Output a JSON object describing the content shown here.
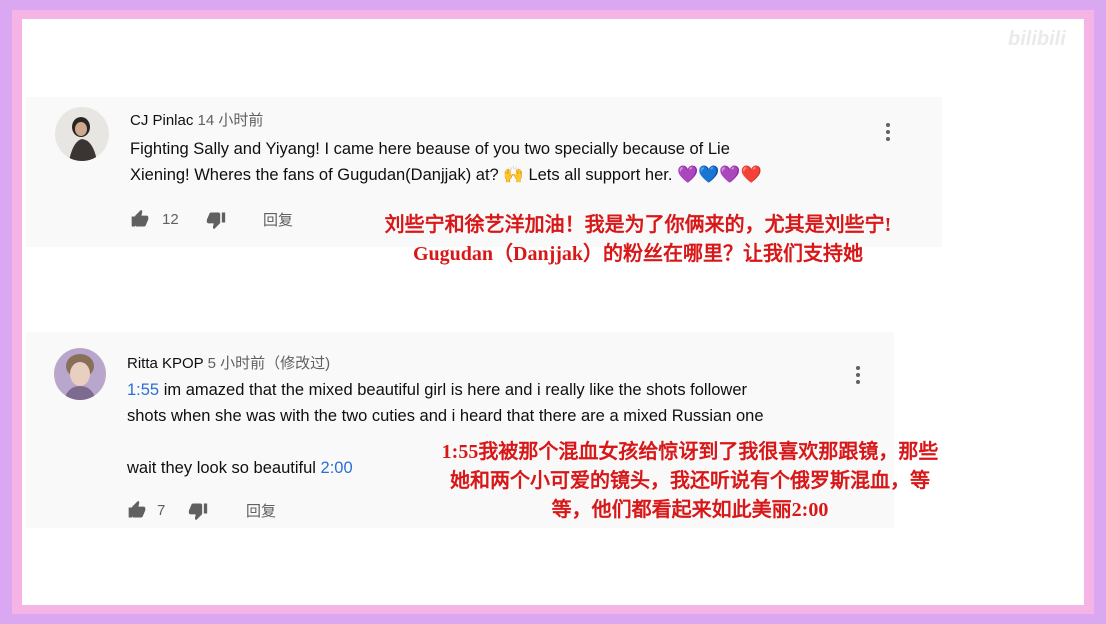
{
  "watermark": "bilibili",
  "comments": [
    {
      "author": "CJ Pinlac",
      "time": "14 小时前",
      "text_line1": "Fighting Sally and Yiyang! I came here beause of you two specially because of Lie",
      "text_line2_a": "Xiening! Wheres the fans of Gugudan(Danjjak) at?",
      "text_line2_emoji": "🙌",
      "text_line2_b": "Lets all support her.",
      "hearts": [
        "💜",
        "💙",
        "💜",
        "❤️"
      ],
      "likes": "12",
      "reply_label": "回复",
      "translation_line1": "刘些宁和徐艺洋加油！我是为了你俩来的，尤其是刘些宁!",
      "translation_line2": "Gugudan（Danjjak）的粉丝在哪里？让我们支持她"
    },
    {
      "author": "Ritta KPOP",
      "time": "5 小时前（修改过)",
      "timestamp_link": "1:55",
      "text_line1": "im amazed that the mixed beautiful girl is here and i really like the  shots follower",
      "text_line2": "shots when she was with the two cuties and i heard that there are a mixed Russian one",
      "text_line3": "wait they look so beautiful",
      "timestamp_link2": "2:00",
      "likes": "7",
      "reply_label": "回复",
      "translation_line1": "1:55我被那个混血女孩给惊讶到了我很喜欢那跟镜，那些",
      "translation_line2": "她和两个小可爱的镜头，我还听说有个俄罗斯混血，等",
      "translation_line3": "等，他们都看起来如此美丽2:00"
    }
  ],
  "colors": {
    "outer_frame": "#d9a8f0",
    "inner_frame": "#f5b3e6",
    "translation_red": "#d81818",
    "link_blue": "#2a6fd6"
  },
  "icons": [
    "thumb-up-icon",
    "thumb-down-icon",
    "more-vert-icon"
  ]
}
